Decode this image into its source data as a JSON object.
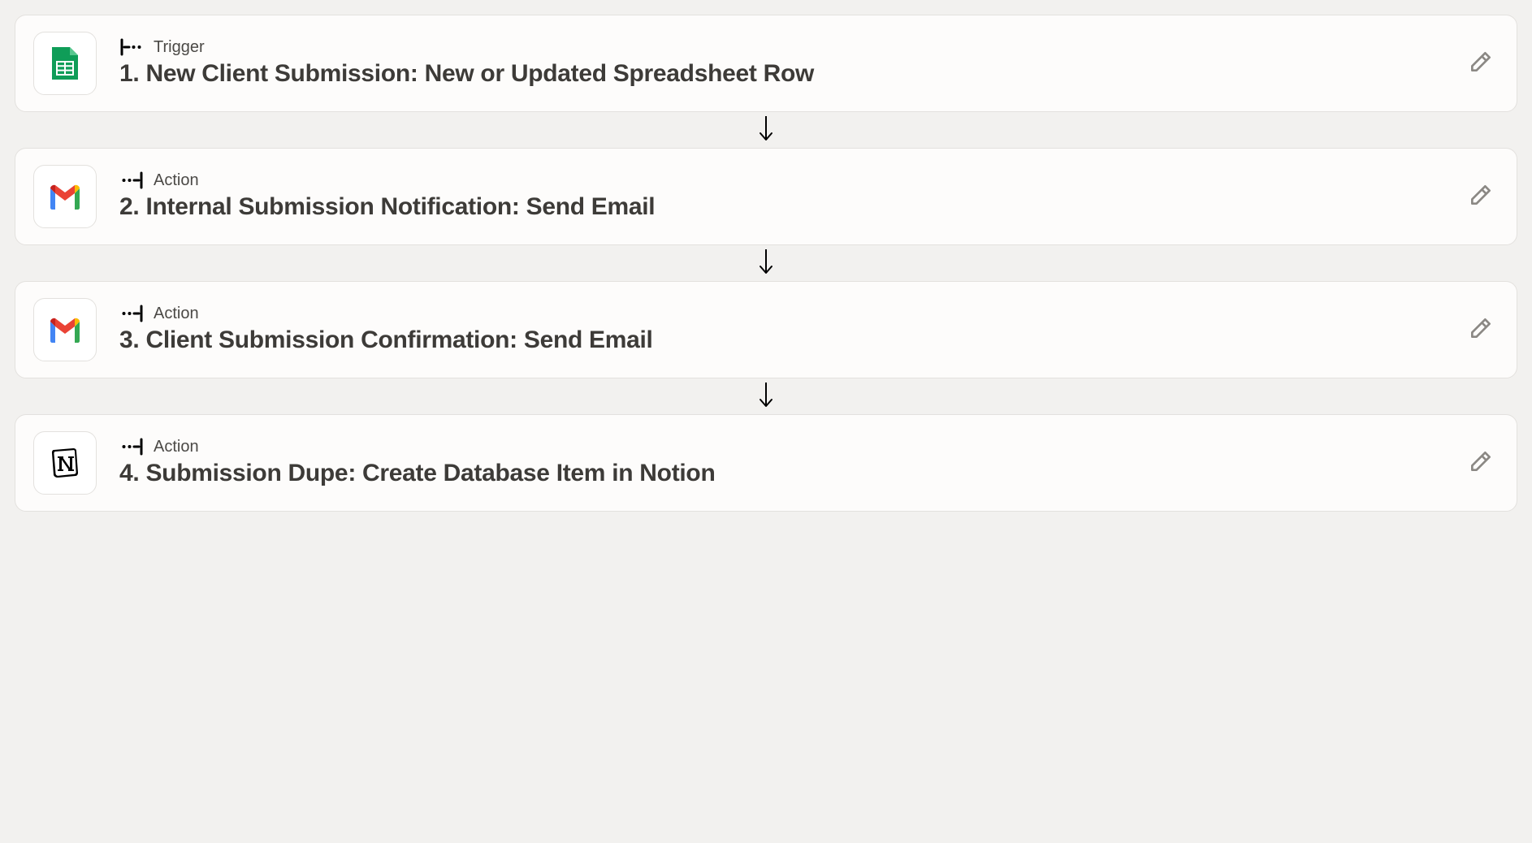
{
  "steps": [
    {
      "app_icon": "google-sheets",
      "kind": "trigger",
      "kind_label": "Trigger",
      "title": "1. New Client Submission: New or Updated Spreadsheet Row"
    },
    {
      "app_icon": "gmail",
      "kind": "action",
      "kind_label": "Action",
      "title": "2. Internal Submission Notification: Send Email"
    },
    {
      "app_icon": "gmail",
      "kind": "action",
      "kind_label": "Action",
      "title": "3. Client Submission Confirmation: Send Email"
    },
    {
      "app_icon": "notion",
      "kind": "action",
      "kind_label": "Action",
      "title": "4. Submission Dupe: Create Database Item in Notion"
    }
  ]
}
